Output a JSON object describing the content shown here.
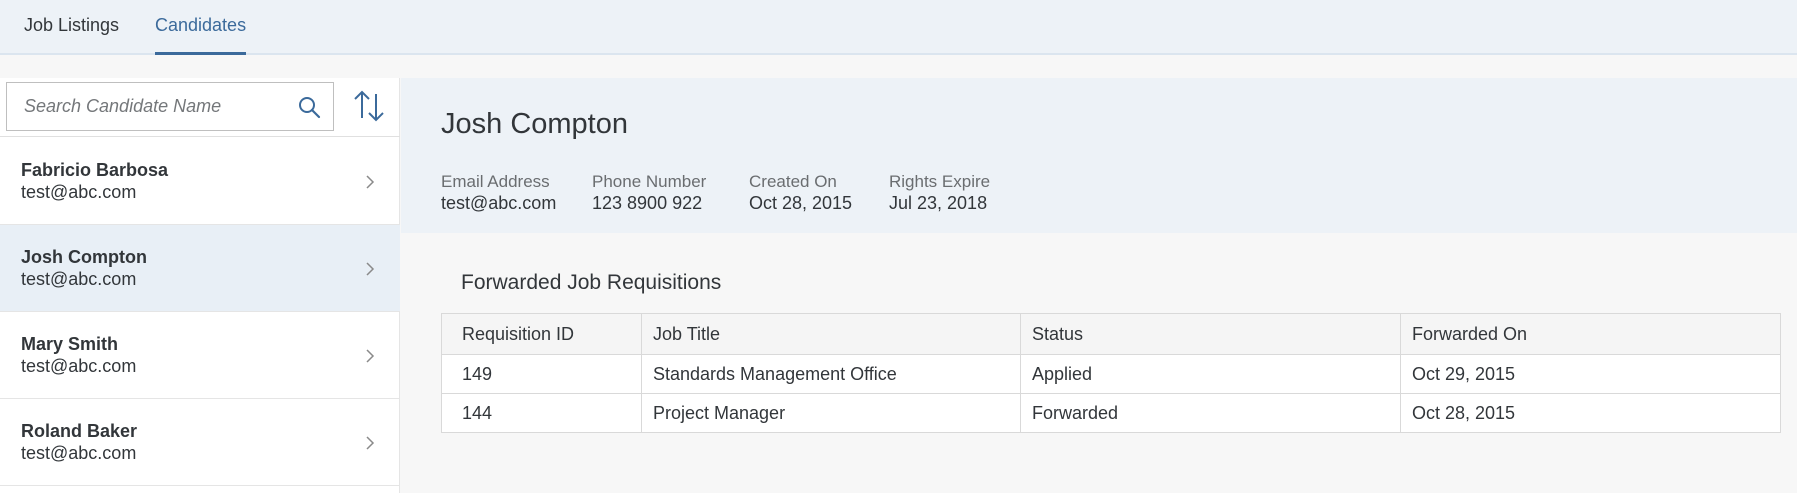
{
  "tabs": [
    {
      "label": "Job Listings",
      "active": false
    },
    {
      "label": "Candidates",
      "active": true
    }
  ],
  "search": {
    "placeholder": "Search Candidate Name",
    "value": ""
  },
  "candidates": [
    {
      "name": "Fabricio Barbosa",
      "email": "test@abc.com",
      "selected": false
    },
    {
      "name": "Josh Compton",
      "email": "test@abc.com",
      "selected": true
    },
    {
      "name": "Mary Smith",
      "email": "test@abc.com",
      "selected": false
    },
    {
      "name": "Roland Baker",
      "email": "test@abc.com",
      "selected": false
    }
  ],
  "detail": {
    "title": "Josh Compton",
    "attributes": [
      {
        "label": "Email Address",
        "value": "test@abc.com"
      },
      {
        "label": "Phone Number",
        "value": "123 8900 922"
      },
      {
        "label": "Created On",
        "value": "Oct 28, 2015"
      },
      {
        "label": "Rights Expire",
        "value": "Jul 23, 2018"
      }
    ],
    "section_title": "Forwarded Job Requisitions",
    "table": {
      "columns": [
        "Requisition ID",
        "Job Title",
        "Status",
        "Forwarded On"
      ],
      "rows": [
        [
          "149",
          "Standards Management Office",
          "Applied",
          "Oct 29, 2015"
        ],
        [
          "144",
          "Project Manager",
          "Forwarded",
          "Oct 28, 2015"
        ]
      ]
    }
  },
  "icons": {
    "search": "search-icon",
    "sort": "sort-icon",
    "chevron": "chevron-right-icon"
  },
  "colors": {
    "accent": "#3b6a9b",
    "header_bg": "#edf2f7",
    "selected_bg": "#e8eff6"
  }
}
